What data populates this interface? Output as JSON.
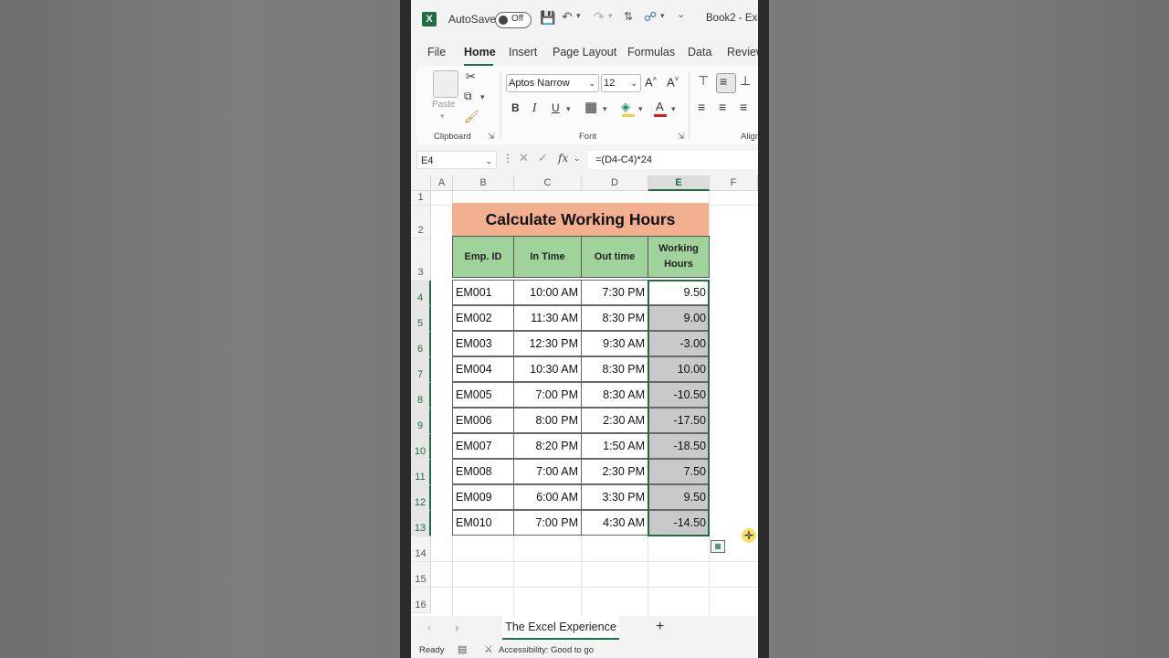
{
  "titlebar": {
    "autosave_label": "AutoSave",
    "toggle_state": "Off",
    "book_title": "Book2 - Exc"
  },
  "tabs": [
    "File",
    "Home",
    "Insert",
    "Page Layout",
    "Formulas",
    "Data",
    "Review"
  ],
  "ribbon": {
    "paste_label": "Paste",
    "font_name": "Aptos Narrow",
    "font_size": "12",
    "clipboard_label": "Clipboard",
    "font_label": "Font",
    "align_label": "Align"
  },
  "formula_bar": {
    "name_box": "E4",
    "fx": "fx",
    "formula": "=(D4-C4)*24"
  },
  "columns": [
    "A",
    "B",
    "C",
    "D",
    "E",
    "F"
  ],
  "rows": [
    "1",
    "2",
    "3",
    "4",
    "5",
    "6",
    "7",
    "8",
    "9",
    "10",
    "11",
    "12",
    "13",
    "14",
    "15",
    "16"
  ],
  "sheet": {
    "title": "Calculate Working Hours",
    "headers": [
      "Emp. ID",
      "In Time",
      "Out time",
      "Working Hours"
    ],
    "data": [
      [
        "EM001",
        "10:00 AM",
        "7:30 PM",
        "9.50"
      ],
      [
        "EM002",
        "11:30 AM",
        "8:30 PM",
        "9.00"
      ],
      [
        "EM003",
        "12:30 PM",
        "9:30 AM",
        "-3.00"
      ],
      [
        "EM004",
        "10:30 AM",
        "8:30 PM",
        "10.00"
      ],
      [
        "EM005",
        "7:00 PM",
        "8:30 AM",
        "-10.50"
      ],
      [
        "EM006",
        "8:00 PM",
        "2:30 AM",
        "-17.50"
      ],
      [
        "EM007",
        "8:20 PM",
        "1:50 AM",
        "-18.50"
      ],
      [
        "EM008",
        "7:00 AM",
        "2:30 PM",
        "7.50"
      ],
      [
        "EM009",
        "6:00 AM",
        "3:30 PM",
        "9.50"
      ],
      [
        "EM010",
        "7:00 PM",
        "4:30 AM",
        "-14.50"
      ]
    ]
  },
  "sheet_tab": "The Excel Experience",
  "status": {
    "ready": "Ready",
    "accessibility": "Accessibility: Good to go"
  },
  "colors": {
    "excel_green": "#1d6f42",
    "title_fill": "#f2b08f",
    "header_fill": "#9fd39b",
    "selection_fill": "#c9c9c9"
  }
}
